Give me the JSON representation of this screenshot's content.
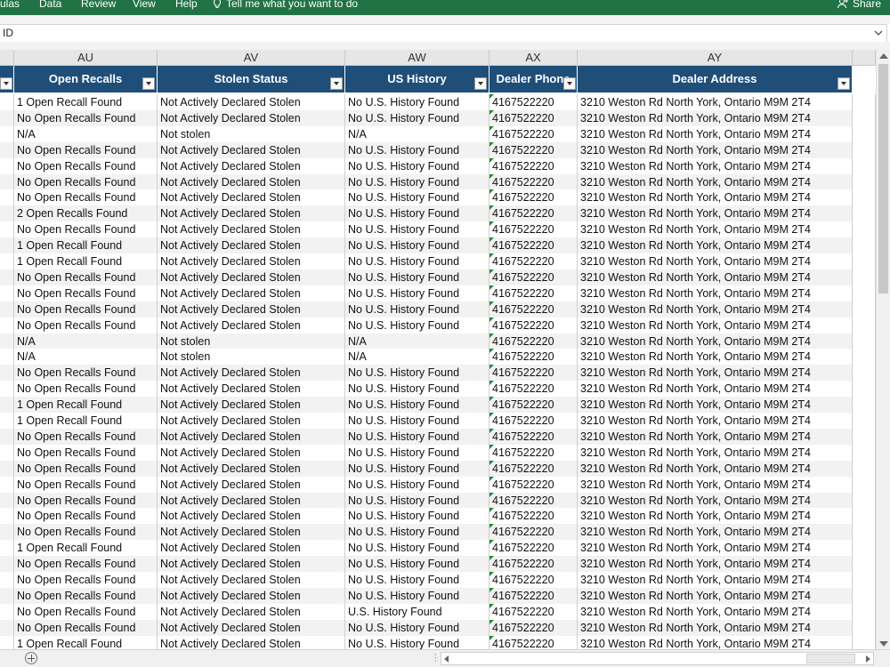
{
  "ribbon": {
    "tabs": [
      "ulas",
      "Data",
      "Review",
      "View",
      "Help"
    ],
    "tell_me": "Tell me what you want to do",
    "share": "Share"
  },
  "formula_bar": {
    "value": "ID"
  },
  "columns": [
    {
      "letter": "AU",
      "header": "Open Recalls"
    },
    {
      "letter": "AV",
      "header": "Stolen Status"
    },
    {
      "letter": "AW",
      "header": "US History"
    },
    {
      "letter": "AX",
      "header": "Dealer Phone"
    },
    {
      "letter": "AY",
      "header": "Dealer Address"
    }
  ],
  "colors": {
    "ribbon": "#217346",
    "header_fill": "#1f4e79",
    "band_fill": "#f2f2f2"
  },
  "rows": [
    [
      "1 Open Recall Found",
      "Not Actively Declared Stolen",
      "No U.S. History Found",
      "4167522220",
      "3210 Weston Rd North York, Ontario M9M 2T4"
    ],
    [
      "No Open Recalls Found",
      "Not Actively Declared Stolen",
      "No U.S. History Found",
      "4167522220",
      "3210 Weston Rd North York, Ontario M9M 2T4"
    ],
    [
      "N/A",
      "Not stolen",
      "N/A",
      "4167522220",
      "3210 Weston Rd North York, Ontario M9M 2T4"
    ],
    [
      "No Open Recalls Found",
      "Not Actively Declared Stolen",
      "No U.S. History Found",
      "4167522220",
      "3210 Weston Rd North York, Ontario M9M 2T4"
    ],
    [
      "No Open Recalls Found",
      "Not Actively Declared Stolen",
      "No U.S. History Found",
      "4167522220",
      "3210 Weston Rd North York, Ontario M9M 2T4"
    ],
    [
      "No Open Recalls Found",
      "Not Actively Declared Stolen",
      "No U.S. History Found",
      "4167522220",
      "3210 Weston Rd North York, Ontario M9M 2T4"
    ],
    [
      "No Open Recalls Found",
      "Not Actively Declared Stolen",
      "No U.S. History Found",
      "4167522220",
      "3210 Weston Rd North York, Ontario M9M 2T4"
    ],
    [
      "2 Open Recalls Found",
      "Not Actively Declared Stolen",
      "No U.S. History Found",
      "4167522220",
      "3210 Weston Rd North York, Ontario M9M 2T4"
    ],
    [
      "No Open Recalls Found",
      "Not Actively Declared Stolen",
      "No U.S. History Found",
      "4167522220",
      "3210 Weston Rd North York, Ontario M9M 2T4"
    ],
    [
      "1 Open Recall Found",
      "Not Actively Declared Stolen",
      "No U.S. History Found",
      "4167522220",
      "3210 Weston Rd North York, Ontario M9M 2T4"
    ],
    [
      "1 Open Recall Found",
      "Not Actively Declared Stolen",
      "No U.S. History Found",
      "4167522220",
      "3210 Weston Rd North York, Ontario M9M 2T4"
    ],
    [
      "No Open Recalls Found",
      "Not Actively Declared Stolen",
      "No U.S. History Found",
      "4167522220",
      "3210 Weston Rd North York, Ontario M9M 2T4"
    ],
    [
      "No Open Recalls Found",
      "Not Actively Declared Stolen",
      "No U.S. History Found",
      "4167522220",
      "3210 Weston Rd North York, Ontario M9M 2T4"
    ],
    [
      "No Open Recalls Found",
      "Not Actively Declared Stolen",
      "No U.S. History Found",
      "4167522220",
      "3210 Weston Rd North York, Ontario M9M 2T4"
    ],
    [
      "No Open Recalls Found",
      "Not Actively Declared Stolen",
      "No U.S. History Found",
      "4167522220",
      "3210 Weston Rd North York, Ontario M9M 2T4"
    ],
    [
      "N/A",
      "Not stolen",
      "N/A",
      "4167522220",
      "3210 Weston Rd North York, Ontario M9M 2T4"
    ],
    [
      "N/A",
      "Not stolen",
      "N/A",
      "4167522220",
      "3210 Weston Rd North York, Ontario M9M 2T4"
    ],
    [
      "No Open Recalls Found",
      "Not Actively Declared Stolen",
      "No U.S. History Found",
      "4167522220",
      "3210 Weston Rd North York, Ontario M9M 2T4"
    ],
    [
      "No Open Recalls Found",
      "Not Actively Declared Stolen",
      "No U.S. History Found",
      "4167522220",
      "3210 Weston Rd North York, Ontario M9M 2T4"
    ],
    [
      "1 Open Recall Found",
      "Not Actively Declared Stolen",
      "No U.S. History Found",
      "4167522220",
      "3210 Weston Rd North York, Ontario M9M 2T4"
    ],
    [
      "1 Open Recall Found",
      "Not Actively Declared Stolen",
      "No U.S. History Found",
      "4167522220",
      "3210 Weston Rd North York, Ontario M9M 2T4"
    ],
    [
      "No Open Recalls Found",
      "Not Actively Declared Stolen",
      "No U.S. History Found",
      "4167522220",
      "3210 Weston Rd North York, Ontario M9M 2T4"
    ],
    [
      "No Open Recalls Found",
      "Not Actively Declared Stolen",
      "No U.S. History Found",
      "4167522220",
      "3210 Weston Rd North York, Ontario M9M 2T4"
    ],
    [
      "No Open Recalls Found",
      "Not Actively Declared Stolen",
      "No U.S. History Found",
      "4167522220",
      "3210 Weston Rd North York, Ontario M9M 2T4"
    ],
    [
      "No Open Recalls Found",
      "Not Actively Declared Stolen",
      "No U.S. History Found",
      "4167522220",
      "3210 Weston Rd North York, Ontario M9M 2T4"
    ],
    [
      "No Open Recalls Found",
      "Not Actively Declared Stolen",
      "No U.S. History Found",
      "4167522220",
      "3210 Weston Rd North York, Ontario M9M 2T4"
    ],
    [
      "No Open Recalls Found",
      "Not Actively Declared Stolen",
      "No U.S. History Found",
      "4167522220",
      "3210 Weston Rd North York, Ontario M9M 2T4"
    ],
    [
      "No Open Recalls Found",
      "Not Actively Declared Stolen",
      "No U.S. History Found",
      "4167522220",
      "3210 Weston Rd North York, Ontario M9M 2T4"
    ],
    [
      "1 Open Recall Found",
      "Not Actively Declared Stolen",
      "No U.S. History Found",
      "4167522220",
      "3210 Weston Rd North York, Ontario M9M 2T4"
    ],
    [
      "No Open Recalls Found",
      "Not Actively Declared Stolen",
      "No U.S. History Found",
      "4167522220",
      "3210 Weston Rd North York, Ontario M9M 2T4"
    ],
    [
      "No Open Recalls Found",
      "Not Actively Declared Stolen",
      "No U.S. History Found",
      "4167522220",
      "3210 Weston Rd North York, Ontario M9M 2T4"
    ],
    [
      "No Open Recalls Found",
      "Not Actively Declared Stolen",
      "No U.S. History Found",
      "4167522220",
      "3210 Weston Rd North York, Ontario M9M 2T4"
    ],
    [
      "No Open Recalls Found",
      "Not Actively Declared Stolen",
      "U.S. History Found",
      "4167522220",
      "3210 Weston Rd North York, Ontario M9M 2T4"
    ],
    [
      "No Open Recalls Found",
      "Not Actively Declared Stolen",
      "No U.S. History Found",
      "4167522220",
      "3210 Weston Rd North York, Ontario M9M 2T4"
    ],
    [
      "1 Open Recall Found",
      "Not Actively Declared Stolen",
      "No U.S. History Found",
      "4167522220",
      "3210 Weston Rd North York, Ontario M9M 2T4"
    ]
  ]
}
